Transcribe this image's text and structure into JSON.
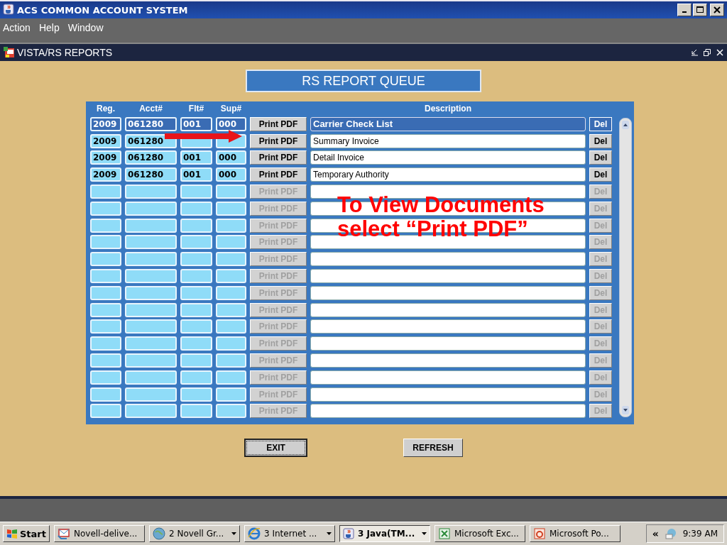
{
  "window": {
    "title": "ACS COMMON ACCOUNT SYSTEM"
  },
  "menu": [
    "Action",
    "Help",
    "Window"
  ],
  "inner_window": {
    "title": "VISTA/RS REPORTS"
  },
  "heading": "RS REPORT QUEUE",
  "table": {
    "columns": [
      "Reg.",
      "Acct#",
      "Flt#",
      "Sup#",
      "Description"
    ],
    "rows": [
      {
        "reg": "2009",
        "acct": "061280",
        "flt": "001",
        "sup": "000",
        "pdf": "Print PDF",
        "description": "Carrier Check List",
        "del": "Del",
        "selected": true,
        "disabled": false
      },
      {
        "reg": "2009",
        "acct": "061280",
        "pdf": "Print PDF",
        "description": "Summary Invoice",
        "del": "Del",
        "selected": false,
        "disabled": false
      },
      {
        "reg": "2009",
        "acct": "061280",
        "flt": "001",
        "sup": "000",
        "pdf": "Print PDF",
        "description": "Detail Invoice",
        "del": "Del",
        "selected": false,
        "disabled": false
      },
      {
        "reg": "2009",
        "acct": "061280",
        "flt": "001",
        "sup": "000",
        "pdf": "Print PDF",
        "description": "Temporary Authority",
        "del": "Del",
        "selected": false,
        "disabled": false
      },
      {
        "pdf": "Print PDF",
        "del": "Del",
        "selected": false,
        "disabled": true
      },
      {
        "pdf": "Print PDF",
        "del": "Del",
        "selected": false,
        "disabled": true
      },
      {
        "pdf": "Print PDF",
        "del": "Del",
        "selected": false,
        "disabled": true
      },
      {
        "pdf": "Print PDF",
        "del": "Del",
        "selected": false,
        "disabled": true
      },
      {
        "pdf": "Print PDF",
        "del": "Del",
        "selected": false,
        "disabled": true
      },
      {
        "pdf": "Print PDF",
        "del": "Del",
        "selected": false,
        "disabled": true
      },
      {
        "pdf": "Print PDF",
        "del": "Del",
        "selected": false,
        "disabled": true
      },
      {
        "pdf": "Print PDF",
        "del": "Del",
        "selected": false,
        "disabled": true
      },
      {
        "pdf": "Print PDF",
        "del": "Del",
        "selected": false,
        "disabled": true
      },
      {
        "pdf": "Print PDF",
        "del": "Del",
        "selected": false,
        "disabled": true
      },
      {
        "pdf": "Print PDF",
        "del": "Del",
        "selected": false,
        "disabled": true
      },
      {
        "pdf": "Print PDF",
        "del": "Del",
        "selected": false,
        "disabled": true
      },
      {
        "pdf": "Print PDF",
        "del": "Del",
        "selected": false,
        "disabled": true
      },
      {
        "pdf": "Print PDF",
        "del": "Del",
        "selected": false,
        "disabled": true
      }
    ]
  },
  "annotation": {
    "lines": [
      "To View Documents",
      "select “Print PDF”"
    ]
  },
  "buttons": [
    "EXIT",
    "REFRESH"
  ],
  "taskbar": {
    "start": "Start",
    "items": [
      {
        "label": "Novell-delive...",
        "kind": "mail",
        "selected": false,
        "group": false
      },
      {
        "label": "2 Novell Gr...",
        "kind": "globe",
        "selected": false,
        "group": true
      },
      {
        "label": "3 Internet ...",
        "kind": "browser",
        "selected": false,
        "group": true
      },
      {
        "label": "3 Java(TM...",
        "kind": "java",
        "selected": true,
        "group": true
      },
      {
        "label": "Microsoft Exc...",
        "kind": "sheet",
        "selected": false,
        "group": false
      },
      {
        "label": "Microsoft Po...",
        "kind": "slides",
        "selected": false,
        "group": false
      }
    ],
    "tray_toggle": "«",
    "clock": "9:39 AM"
  }
}
